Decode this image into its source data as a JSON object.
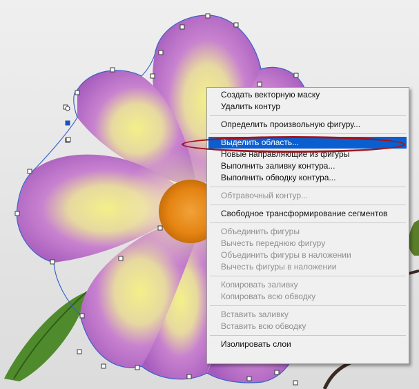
{
  "context_menu": {
    "groups": [
      [
        {
          "label": "Создать векторную маску",
          "enabled": true
        },
        {
          "label": "Удалить контур",
          "enabled": true
        }
      ],
      [
        {
          "label": "Определить произвольную фигуру...",
          "enabled": true
        }
      ],
      [
        {
          "label": "Выделить область...",
          "enabled": true,
          "highlighted": true
        },
        {
          "label": "Новые направляющие из фигуры",
          "enabled": true
        },
        {
          "label": "Выполнить заливку контура...",
          "enabled": true
        },
        {
          "label": "Выполнить обводку контура...",
          "enabled": true
        }
      ],
      [
        {
          "label": "Обтравочный контур...",
          "enabled": false
        }
      ],
      [
        {
          "label": "Свободное трансформирование сегментов",
          "enabled": true
        }
      ],
      [
        {
          "label": "Объединить фигуры",
          "enabled": false
        },
        {
          "label": "Вычесть переднюю фигуру",
          "enabled": false
        },
        {
          "label": "Объединить фигуры в наложении",
          "enabled": false
        },
        {
          "label": "Вычесть фигуры в наложении",
          "enabled": false
        }
      ],
      [
        {
          "label": "Копировать заливку",
          "enabled": false
        },
        {
          "label": "Копировать всю обводку",
          "enabled": false
        }
      ],
      [
        {
          "label": "Вставить заливку",
          "enabled": false
        },
        {
          "label": "Вставить всю обводку",
          "enabled": false
        }
      ],
      [
        {
          "label": "Изолировать слои",
          "enabled": true
        }
      ]
    ]
  },
  "colors": {
    "highlight": "#0a5fd0",
    "annotation": "#a3121b",
    "petal": "#b25cc4",
    "center": "#e88a12",
    "path_stroke": "#3a62c8"
  },
  "icons": [
    "path-anchor-point-icon"
  ]
}
